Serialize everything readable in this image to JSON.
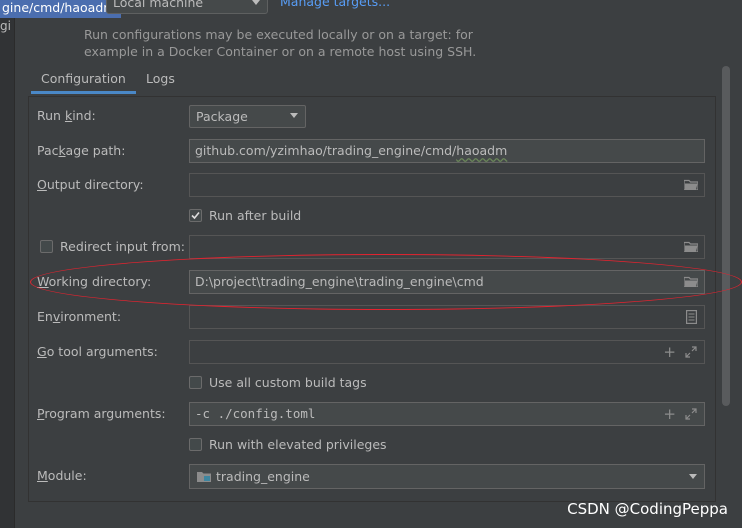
{
  "top": {
    "breadcrumb_selected": "gine/cmd/haoadm",
    "left_stub": "gi",
    "target_value": "Local machine",
    "manage_targets": "Manage targets...",
    "description": "Run configurations may be executed locally or on a target: for example in a Docker Container or on a remote host using SSH."
  },
  "tabs": [
    {
      "label": "Configuration",
      "active": true
    },
    {
      "label": "Logs",
      "active": false
    }
  ],
  "form": {
    "run_kind": {
      "label_pre": "Run ",
      "label_u": "k",
      "label_post": "ind:",
      "value": "Package"
    },
    "package_path": {
      "label_pre": "Pac",
      "label_u": "k",
      "label_post": "age path:",
      "value_plain": "github.com/yzimhao/trading_engine/cmd/",
      "value_squiggle": "haoadm"
    },
    "output_directory": {
      "label_pre": "",
      "label_u": "O",
      "label_post": "utput directory:",
      "value": ""
    },
    "run_after_build": {
      "label": "Run after build",
      "checked": true
    },
    "redirect_input": {
      "label": "Redirect input from:",
      "checked": false,
      "value": ""
    },
    "working_directory": {
      "label_pre": "",
      "label_u": "W",
      "label_post": "orking directory:",
      "value": "D:\\project\\trading_engine\\trading_engine\\cmd"
    },
    "environment": {
      "label_pre": "En",
      "label_u": "v",
      "label_post": "ironment:",
      "value": ""
    },
    "go_tool_arguments": {
      "label_pre": "",
      "label_u": "G",
      "label_post": "o tool arguments:",
      "value": ""
    },
    "use_custom_build_tags": {
      "label": "Use all custom build tags",
      "checked": false
    },
    "program_arguments": {
      "label_pre": "",
      "label_u": "P",
      "label_post": "rogram arguments:",
      "value": "-c ./config.toml"
    },
    "run_elevated": {
      "label": "Run with elevated privileges",
      "checked": false
    },
    "module": {
      "label_pre": "",
      "label_u": "M",
      "label_post": "odule:",
      "value": "trading_engine"
    }
  },
  "icons": {
    "folder": "folder-icon",
    "document": "document-icon",
    "plus": "plus-icon",
    "expand": "expand-icon",
    "module": "module-icon"
  },
  "colors": {
    "background": "#3c3f41",
    "accent_tab": "#4a88c7",
    "link": "#589df6",
    "selection": "#4b6eaf",
    "annotation_ellipse": "#e4232f"
  },
  "watermark": "CSDN @CodingPeppa"
}
